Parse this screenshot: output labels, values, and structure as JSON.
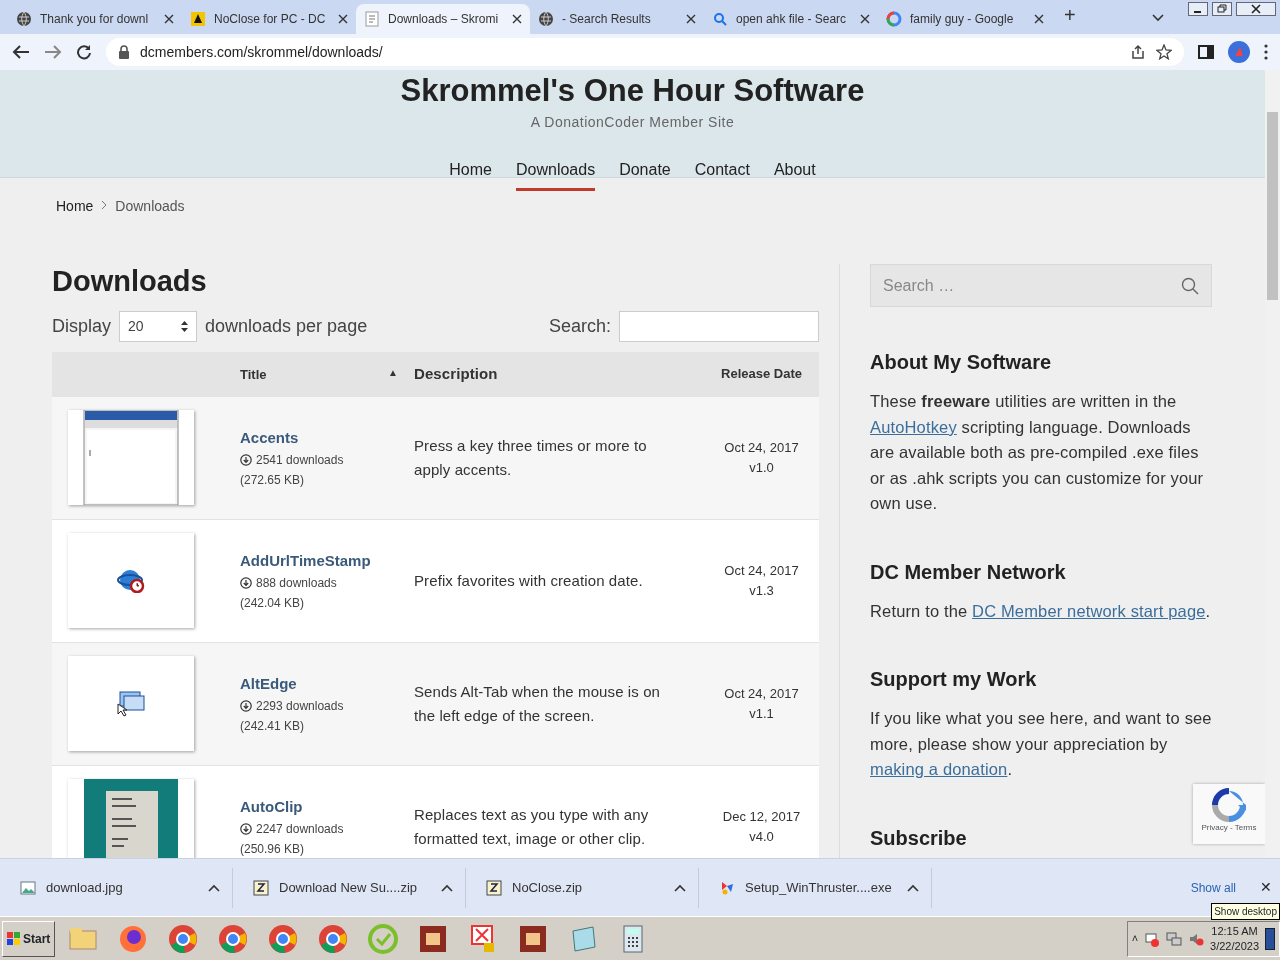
{
  "browser": {
    "tabs": [
      {
        "title": "Thank you for downl",
        "selected": false
      },
      {
        "title": "NoClose for PC - DC",
        "selected": false
      },
      {
        "title": "Downloads – Skromi",
        "selected": true
      },
      {
        "title": "- Search Results",
        "selected": false
      },
      {
        "title": "open ahk file - Searc",
        "selected": false
      },
      {
        "title": "family guy - Google",
        "selected": false
      }
    ],
    "new_tab": "+",
    "address": "dcmembers.com/skrommel/downloads/"
  },
  "site": {
    "title": "Skrommel's One Hour Software",
    "tagline": "A DonationCoder Member Site",
    "nav": [
      {
        "label": "Home",
        "selected": false
      },
      {
        "label": "Downloads",
        "selected": true
      },
      {
        "label": "Donate",
        "selected": false
      },
      {
        "label": "Contact",
        "selected": false
      },
      {
        "label": "About",
        "selected": false
      }
    ]
  },
  "breadcrumb": [
    {
      "label": "Home",
      "kind": "link"
    },
    {
      "label": "Downloads",
      "kind": "current"
    }
  ],
  "downloads": {
    "heading": "Downloads",
    "display_label": "Display",
    "page_size": "20",
    "per_page_label": "downloads per page",
    "search_label": "Search:",
    "columns": [
      {
        "label": "Title",
        "sort_indicator": "▲"
      },
      {
        "label": "Description"
      },
      {
        "label": "Release Date"
      }
    ],
    "rows": [
      {
        "title": "Accents",
        "downloads": "2541 downloads",
        "size": "(272.65 KB)",
        "description": "Press a key three times or more to apply accents.",
        "date": "Oct 24, 2017",
        "version": "v1.0"
      },
      {
        "title": "AddUrlTimeStamp",
        "downloads": "888 downloads",
        "size": "(242.04 KB)",
        "description": "Prefix favorites with creation date.",
        "date": "Oct 24, 2017",
        "version": "v1.3"
      },
      {
        "title": "AltEdge",
        "downloads": "2293 downloads",
        "size": "(242.41 KB)",
        "description": "Sends Alt-Tab when the mouse is on the left edge of the screen.",
        "date": "Oct 24, 2017",
        "version": "v1.1"
      },
      {
        "title": "AutoClip",
        "downloads": "2247 downloads",
        "size": "(250.96 KB)",
        "description": "Replaces text as you type with any formatted text, image or other clip.",
        "date": "Dec 12, 2017",
        "version": "v4.0"
      }
    ]
  },
  "sidebar": {
    "search_placeholder": "Search …",
    "widgets": [
      {
        "heading": "About My Software",
        "paragraph": [
          {
            "kind": "text",
            "text": "These "
          },
          {
            "kind": "bold",
            "text": "freeware"
          },
          {
            "kind": "text",
            "text": " utilities are written in the "
          },
          {
            "kind": "link",
            "text": "AutoHotkey"
          },
          {
            "kind": "text",
            "text": " scripting language. Downloads are available both as pre-compiled .exe files or as .ahk scripts you can customize for your own use."
          }
        ]
      },
      {
        "heading": "DC Member Network",
        "paragraph": [
          {
            "kind": "text",
            "text": "Return to the "
          },
          {
            "kind": "link",
            "text": "DC Member network start page"
          },
          {
            "kind": "text",
            "text": "."
          }
        ]
      },
      {
        "heading": "Support my Work",
        "paragraph": [
          {
            "kind": "text",
            "text": "If you like what you see here, and want to see more, please show your appreciation by "
          },
          {
            "kind": "link",
            "text": "making a donation"
          },
          {
            "kind": "text",
            "text": "."
          }
        ]
      },
      {
        "heading": "Subscribe"
      }
    ],
    "recaptcha": "Privacy - Terms"
  },
  "download_bar": {
    "items": [
      {
        "name": "download.jpg"
      },
      {
        "name": "Download New Su....zip"
      },
      {
        "name": "NoClose.zip"
      },
      {
        "name": "Setup_WinThruster....exe"
      }
    ],
    "show_all": "Show all",
    "close": "✕"
  },
  "taskbar": {
    "start": "Start",
    "tray_expand": "˄",
    "time": "12:15 AM",
    "date": "3/22/2023",
    "tooltip": "Show desktop"
  }
}
